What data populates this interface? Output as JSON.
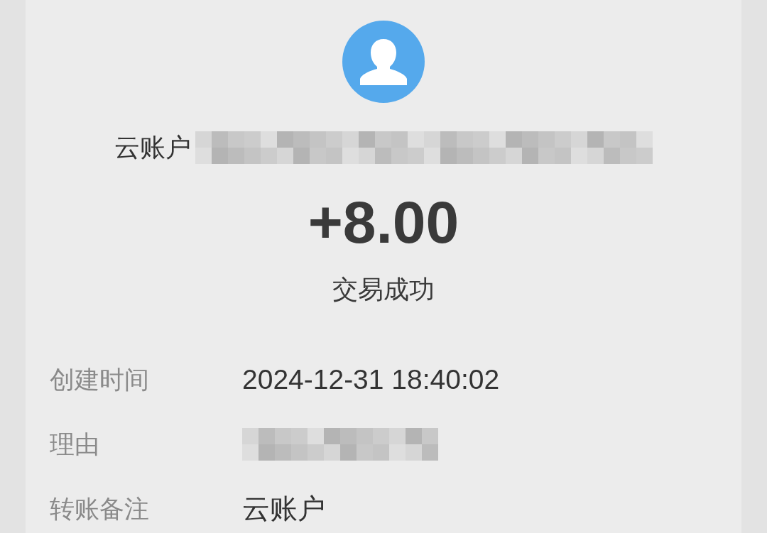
{
  "payer": {
    "name": "云账户",
    "redacted": true
  },
  "amount": "+8.00",
  "status": "交易成功",
  "details": [
    {
      "label": "创建时间",
      "value": "2024-12-31 18:40:02",
      "redacted": false
    },
    {
      "label": "理由",
      "redacted": true
    },
    {
      "label": "转账备注",
      "value": "云账户",
      "redacted": false
    }
  ]
}
